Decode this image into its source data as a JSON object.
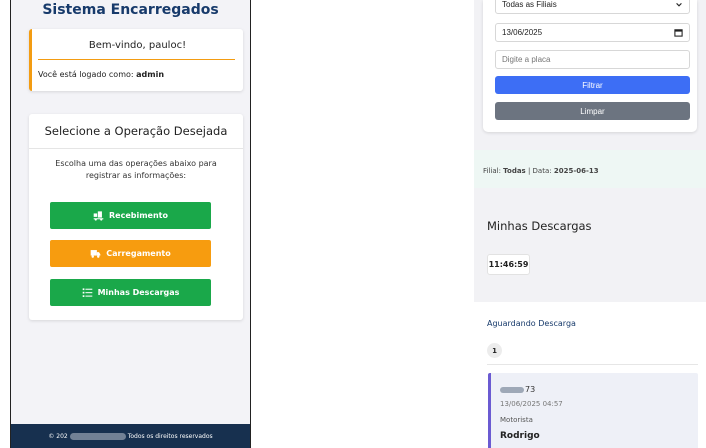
{
  "left_panel": {
    "app_title": "Sistema Encarregados",
    "welcome": {
      "title": "Bem-vindo, pauloc!",
      "logged_prefix": "Você está logado como: ",
      "logged_role": "admin"
    },
    "operations": {
      "title": "Selecione a Operação Desejada",
      "description": "Escolha uma das operações abaixo para registrar as informações:",
      "buttons": [
        {
          "label": "Recebimento",
          "icon": "truck-loading-icon",
          "color": "#1aa84a"
        },
        {
          "label": "Carregamento",
          "icon": "truck-icon",
          "color": "#f79c0f"
        },
        {
          "label": "Minhas Descargas",
          "icon": "list-icon",
          "color": "#1aa84a"
        }
      ]
    },
    "footer": {
      "prefix": "© 202",
      "suffix": "Todos os direitos reservados"
    }
  },
  "right_panel": {
    "filters": {
      "branch_select": "Todas as Filiais",
      "date_input": "13/06/2025",
      "plate_placeholder": "Digite a placa",
      "filter_button": "Filtrar",
      "clear_button": "Limpar"
    },
    "info": {
      "branch_label": "Filial: ",
      "branch_value": "Todas",
      "separator": " | Data: ",
      "date_value": "2025-06-13"
    },
    "section_title": "Minhas Descargas",
    "clock": "11:46:59",
    "waiting": {
      "title": "Aguardando Descarga",
      "count": "1",
      "entry": {
        "plate_suffix": "73",
        "datetime": "13/06/2025 04:57",
        "role": "Motorista",
        "name": "Rodrigo"
      }
    }
  },
  "colors": {
    "title_navy": "#173a6b",
    "green": "#1aa84a",
    "orange": "#f79c0f",
    "blue": "#3d6ef5",
    "gray": "#6c7480",
    "footer": "#17304f",
    "entry_accent": "#6b5bd2"
  }
}
